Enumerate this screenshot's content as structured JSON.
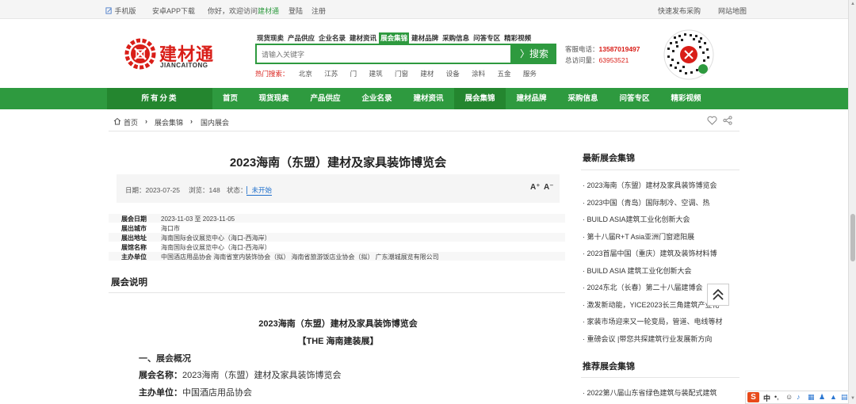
{
  "topbar": {
    "mobile": "手机版",
    "app": "安卓APP下载",
    "greeting": "你好，欢迎访问",
    "site": "建材通",
    "login": "登陆",
    "register": "注册",
    "quick_purchase": "快速发布采购",
    "sitemap": "网站地图"
  },
  "brand": {
    "cn": "建材通",
    "en": "JIANCAITONG",
    "color": "#d91e18"
  },
  "search": {
    "tabs": [
      "现货现卖",
      "产品供应",
      "企业名录",
      "建材资讯",
      "展会集锦",
      "建材品牌",
      "采购信息",
      "问答专区",
      "精彩视频"
    ],
    "active_tab": "展会集锦",
    "placeholder": "请输入关键字",
    "button": "搜索",
    "hot_label": "热门搜索：",
    "hot": [
      "北京",
      "江苏",
      "门",
      "建筑",
      "门窗",
      "建材",
      "设备",
      "涂料",
      "五金",
      "服务"
    ]
  },
  "contact": {
    "phone_label": "客服电话：",
    "phone": "13587019497",
    "qq_label": "总访问量：",
    "qq": "63953521"
  },
  "nav": {
    "all": "所有分类",
    "items": [
      "首页",
      "现货现卖",
      "产品供应",
      "企业名录",
      "建材资讯",
      "展会集锦",
      "建材品牌",
      "采购信息",
      "问答专区",
      "精彩视频"
    ],
    "active": "展会集锦"
  },
  "breadcrumb": [
    "首页",
    "展会集锦",
    "国内展会"
  ],
  "article": {
    "title": "2023海南（东盟）建材及家具装饰博览会",
    "date": "日期：2023-07-25",
    "views": "浏览：148",
    "status_label": "状态：",
    "status": "未开始",
    "font_up": "A⁺",
    "font_down": "A⁻"
  },
  "info": [
    {
      "label": "展会日期",
      "value": "2023-11-03 至 2023-11-05"
    },
    {
      "label": "展出城市",
      "value": "海口市"
    },
    {
      "label": "展出地址",
      "value": "海南国际会议展览中心（海口-西海岸）"
    },
    {
      "label": "展馆名称",
      "value": "海南国际会议展览中心（海口-西海岸）"
    },
    {
      "label": "主办单位",
      "value": "中国酒店用品协会 海南省室内装饰协会（拟） 海南省旅游饭店业协会（拟） 广东潮城展览有限公司"
    }
  ],
  "section_heading": "展会说明",
  "content": {
    "title": "2023海南（东盟）建材及家具装饰博览会",
    "subtitle": "【THE 海南建装展】",
    "overview": "一、展会概况",
    "name_label": "展会名称：",
    "name_value": "2023海南（东盟）建材及家具装饰博览会",
    "host_label": "主办单位：",
    "host_value": "中国酒店用品协会"
  },
  "sidebar": {
    "latest_heading": "最新展会集锦",
    "latest": [
      "· 2023海南（东盟）建材及家具装饰博览会",
      "· 2023中国（青岛）国际制冷、空调、热",
      "· BUILD ASIA建筑工业化创新大会",
      "· 第十八届R+T Asia亚洲门窗遮阳展",
      "· 2023首届中国（重庆）建筑及装饰材料博",
      "· BUILD ASIA 建筑工业化创新大会",
      "· 2024东北（长春）第二十八届建博会",
      "· 激发新动能，YICE2023长三角建筑产业化",
      "· 家装市场迎来又一轮变局，管道、电线等材",
      "· 重磅会议 |带您共探建筑行业发展新方向"
    ],
    "recommend_heading": "推荐展会集锦",
    "recommend": [
      "· 2022第八届山东省绿色建筑与装配式建筑"
    ]
  },
  "ime": {
    "logo": "S",
    "lang": "中"
  }
}
